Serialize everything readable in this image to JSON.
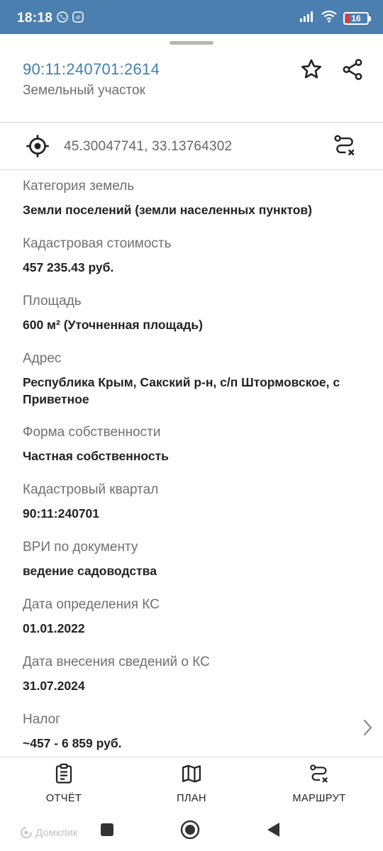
{
  "status_bar": {
    "time": "18:18",
    "battery": "16"
  },
  "header": {
    "cadastral_number": "90:11:240701:2614",
    "object_type": "Земельный участок"
  },
  "coordinates": "45.30047741, 33.13764302",
  "properties": [
    {
      "label": "Категория земель",
      "value": "Земли поселений (земли населенных пунктов)"
    },
    {
      "label": "Кадастровая стоимость",
      "value": "457 235.43 руб."
    },
    {
      "label": "Площадь",
      "value": "600 м² (Уточненная площадь)"
    },
    {
      "label": "Адрес",
      "value": "Республика Крым, Сакский р-н, с/п Штормовское, с Приветное"
    },
    {
      "label": "Форма собственности",
      "value": "Частная собственность"
    },
    {
      "label": "Кадастровый квартал",
      "value": "90:11:240701"
    },
    {
      "label": "ВРИ по документу",
      "value": "ведение садоводства"
    },
    {
      "label": "Дата определения КС",
      "value": "01.01.2022"
    },
    {
      "label": "Дата внесения сведений о КС",
      "value": "31.07.2024"
    },
    {
      "label": "Налог",
      "value": "~457 - 6 859 руб."
    }
  ],
  "bottom_nav": {
    "report": "ОТЧЁТ",
    "plan": "ПЛАН",
    "route": "МАРШРУТ"
  },
  "watermark": "Домклик",
  "colors": {
    "status_bar": "#4a7fb0",
    "accent": "#3f7fb1",
    "battery_low": "#e53935"
  },
  "icons": [
    "phone-call-icon",
    "notification-icon",
    "signal-icon",
    "wifi-icon",
    "battery-icon",
    "star-icon",
    "share-icon",
    "crosshair-icon",
    "route-icon",
    "chevron-right-icon",
    "report-icon",
    "map-icon",
    "home-button",
    "back-button",
    "recents-button"
  ]
}
